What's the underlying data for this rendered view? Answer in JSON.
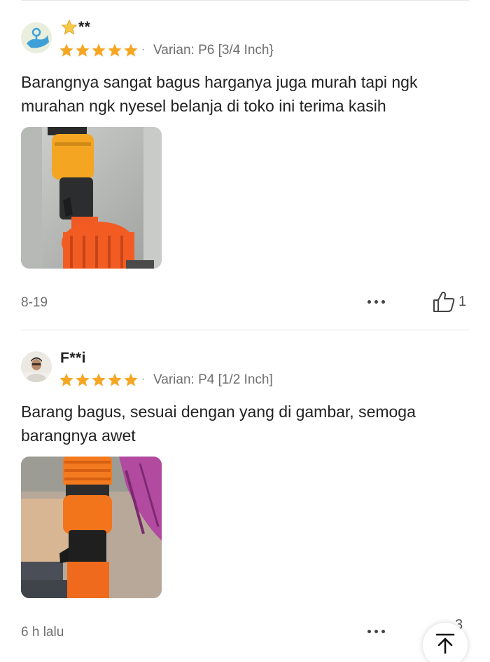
{
  "reviews": [
    {
      "username": "**",
      "rating": 5,
      "variant_sep": "·",
      "variant": "Varian: P6 [3/4 Inch}",
      "text_line1": "Barangnya sangat bagus harganya juga murah tapi ngk",
      "text_line2": "murahan ngk nyesel belanja di toko ini terima kasih",
      "date": "8-19",
      "likes": "1"
    },
    {
      "username": "F**i",
      "rating": 5,
      "variant_sep": "·",
      "variant": "Varian: P4 [1/2 Inch]",
      "text_line1": "Barang bagus, sesuai dengan yang di gambar, semoga",
      "text_line2": "barangnya awet",
      "date": "6 h lalu",
      "likes": "3"
    }
  ],
  "colors": {
    "star": "#f5a623",
    "text": "#222222",
    "muted": "#6f6f6f",
    "divider": "#e6e6e6"
  },
  "icons": {
    "like": "thumbs-up-icon",
    "more": "more-dots-icon",
    "back_to_top": "arrow-up-to-top-icon",
    "star": "star-icon"
  }
}
